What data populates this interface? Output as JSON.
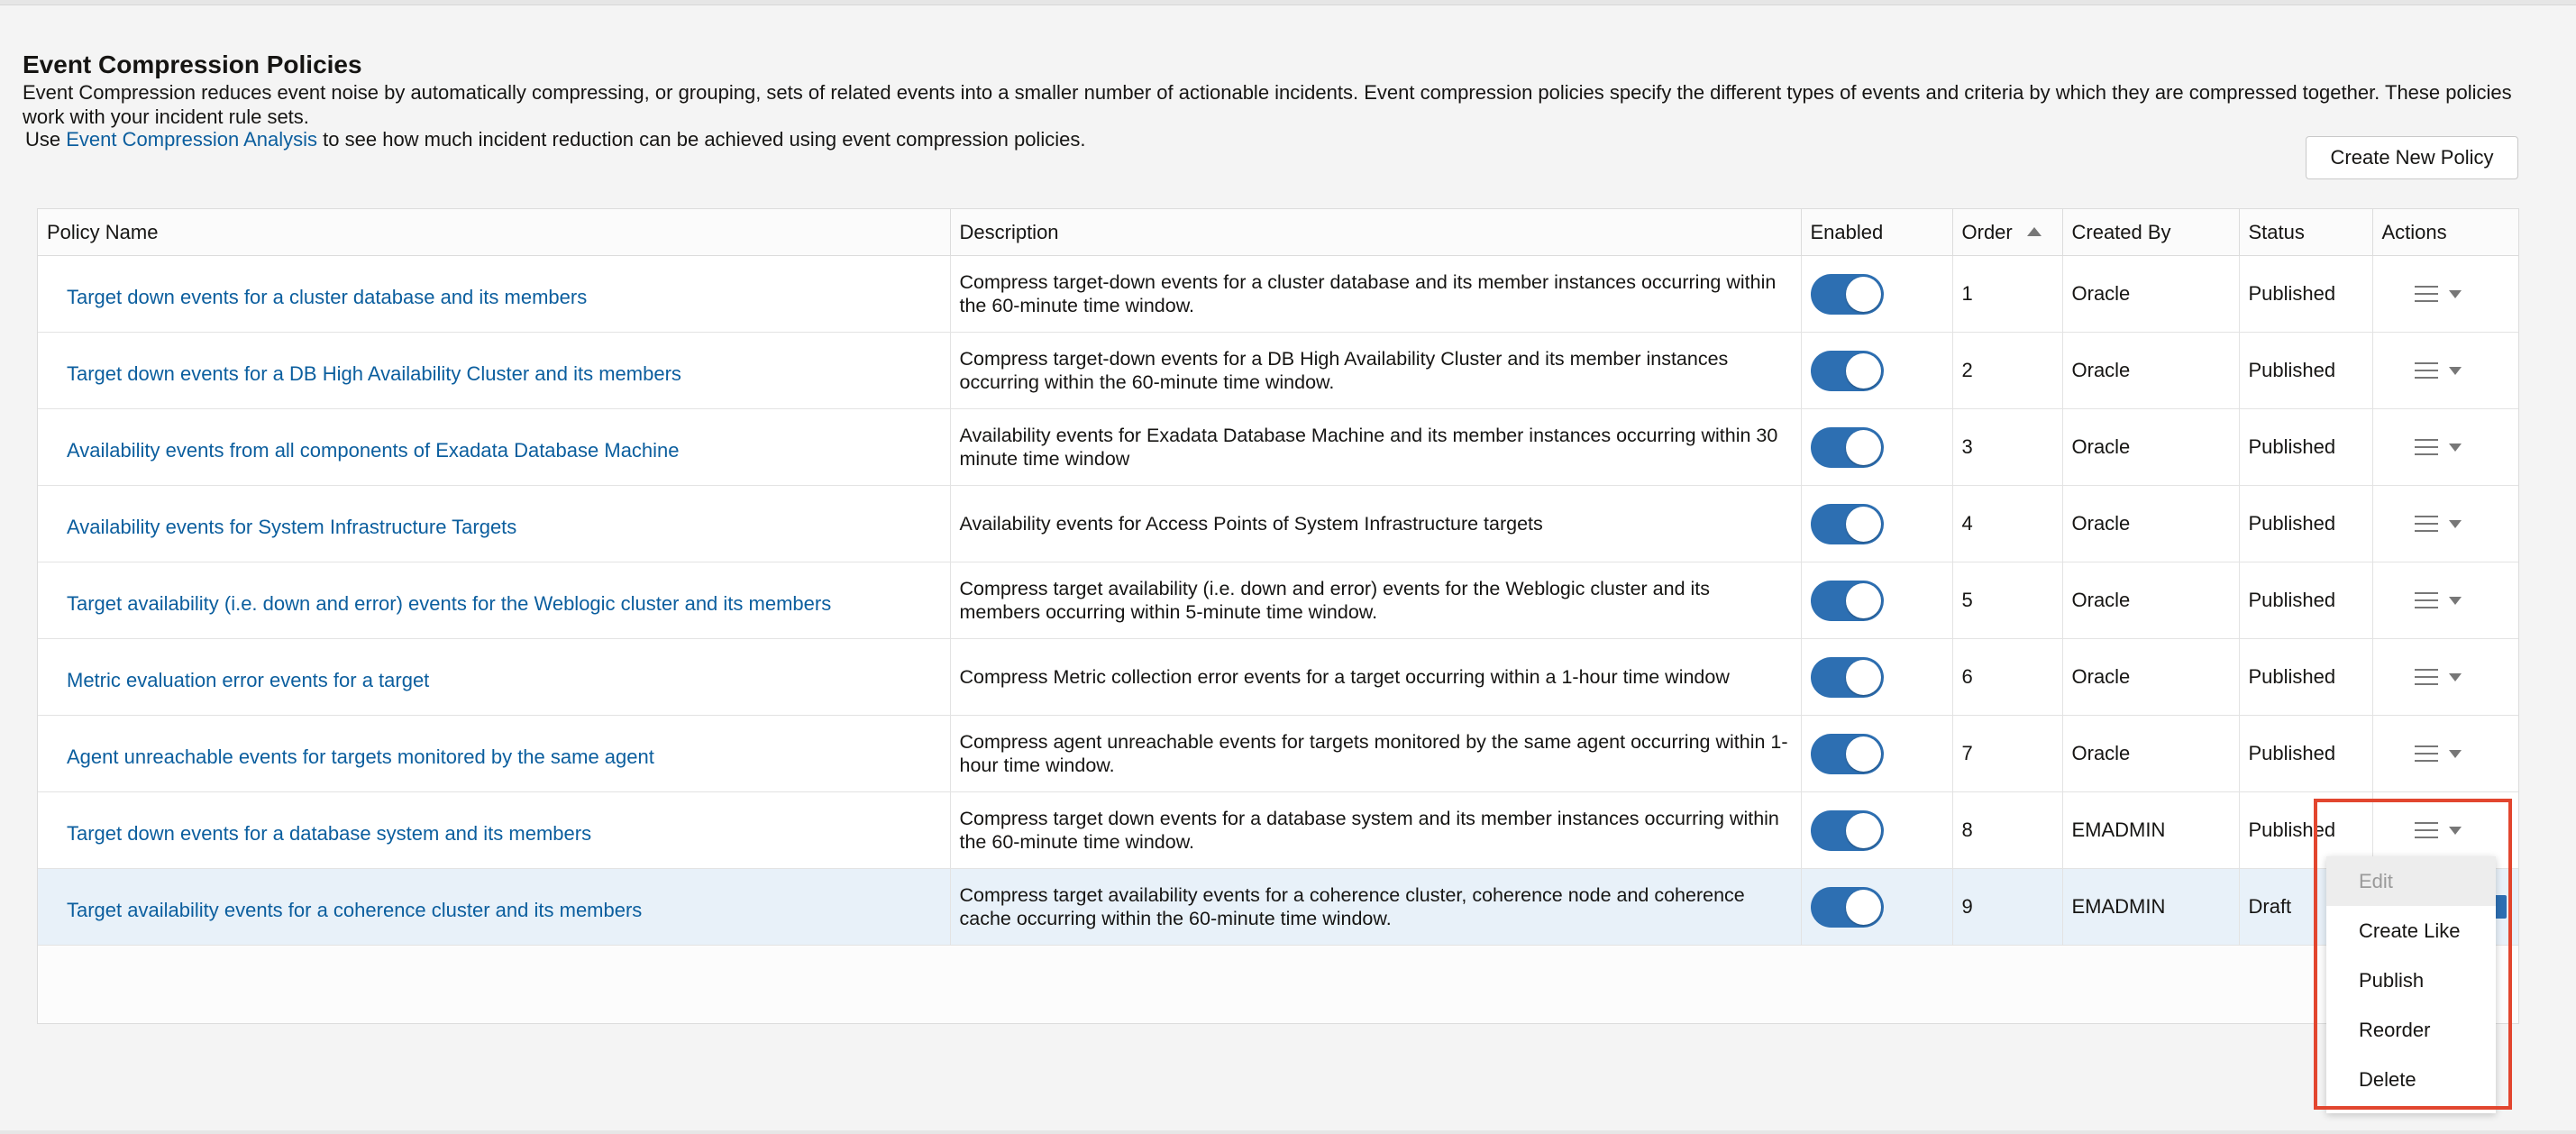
{
  "page": {
    "title": "Event Compression Policies",
    "description": "Event Compression reduces event noise by automatically compressing, or grouping, sets of related events into a smaller number of actionable incidents. Event compression policies specify the different types of events and criteria by which they are compressed together. These policies work with your incident rule sets.",
    "use_prefix": "Use",
    "use_link": "Event Compression Analysis",
    "use_suffix": "to see how much incident reduction can be achieved using event compression policies.",
    "create_button": "Create New Policy"
  },
  "table": {
    "columns": {
      "name": "Policy Name",
      "description": "Description",
      "enabled": "Enabled",
      "order": "Order",
      "created_by": "Created By",
      "status": "Status",
      "actions": "Actions"
    },
    "rows": [
      {
        "name": "Target down events for a cluster database and its members",
        "description": "Compress target-down events for a cluster database and its member instances occurring within the 60-minute time window.",
        "enabled": true,
        "order": "1",
        "created_by": "Oracle",
        "status": "Published"
      },
      {
        "name": "Target down events for a DB High Availability Cluster and its members",
        "description": "Compress target-down events for a DB High Availability Cluster and its member instances occurring within the 60-minute time window.",
        "enabled": true,
        "order": "2",
        "created_by": "Oracle",
        "status": "Published"
      },
      {
        "name": "Availability events from all components of Exadata Database Machine",
        "description": "Availability events for Exadata Database Machine and its member instances occurring within 30 minute time window",
        "enabled": true,
        "order": "3",
        "created_by": "Oracle",
        "status": "Published"
      },
      {
        "name": "Availability events for System Infrastructure Targets",
        "description": "Availability events for Access Points of System Infrastructure targets",
        "enabled": true,
        "order": "4",
        "created_by": "Oracle",
        "status": "Published"
      },
      {
        "name": "Target availability (i.e. down and error) events for the Weblogic cluster and its members",
        "description": "Compress target availability (i.e. down and error) events for the Weblogic cluster and its members occurring within 5-minute time window.",
        "enabled": true,
        "order": "5",
        "created_by": "Oracle",
        "status": "Published"
      },
      {
        "name": "Metric evaluation error events for a target",
        "description": "Compress Metric collection error events for a target occurring within a 1-hour time window",
        "enabled": true,
        "order": "6",
        "created_by": "Oracle",
        "status": "Published"
      },
      {
        "name": "Agent unreachable events for targets monitored by the same agent",
        "description": "Compress agent unreachable events for targets monitored by the same agent occurring within 1-hour time window.",
        "enabled": true,
        "order": "7",
        "created_by": "Oracle",
        "status": "Published"
      },
      {
        "name": "Target down events for a database system and its members",
        "description": "Compress target down events for a database system and its member instances occurring within the 60-minute time window.",
        "enabled": true,
        "order": "8",
        "created_by": "EMADMIN",
        "status": "Published"
      },
      {
        "name": "Target availability events for a coherence cluster and its members",
        "description": "Compress target availability events for a coherence cluster, coherence node and coherence cache occurring within the 60-minute time window.",
        "enabled": true,
        "order": "9",
        "created_by": "EMADMIN",
        "status": "Draft",
        "selected": true
      }
    ]
  },
  "actions_menu": {
    "items": [
      {
        "label": "Edit",
        "disabled": true
      },
      {
        "label": "Create Like",
        "disabled": false
      },
      {
        "label": "Publish",
        "disabled": false
      },
      {
        "label": "Reorder",
        "disabled": false
      },
      {
        "label": "Delete",
        "disabled": false
      }
    ]
  },
  "colors": {
    "accent": "#2d6fb2",
    "link": "#0b5e9e",
    "highlight_box": "#e2462f"
  },
  "icons": {
    "actions": "hamburger-menu-icon",
    "dropdown": "caret-down-icon",
    "sort": "sort-ascending-icon"
  }
}
